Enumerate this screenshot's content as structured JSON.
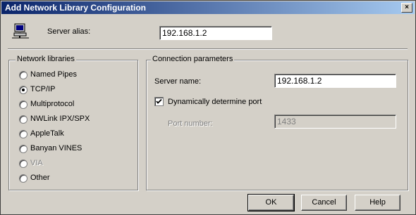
{
  "window": {
    "title": "Add Network Library Configuration",
    "close_glyph": "×"
  },
  "server_alias": {
    "label": "Server alias:",
    "value": "192.168.1.2"
  },
  "network_libraries": {
    "title": "Network libraries",
    "options": [
      {
        "label": "Named Pipes",
        "checked": false,
        "disabled": false
      },
      {
        "label": "TCP/IP",
        "checked": true,
        "disabled": false
      },
      {
        "label": "Multiprotocol",
        "checked": false,
        "disabled": false
      },
      {
        "label": "NWLink IPX/SPX",
        "checked": false,
        "disabled": false
      },
      {
        "label": "AppleTalk",
        "checked": false,
        "disabled": false
      },
      {
        "label": "Banyan VINES",
        "checked": false,
        "disabled": false
      },
      {
        "label": "VIA",
        "checked": false,
        "disabled": true
      },
      {
        "label": "Other",
        "checked": false,
        "disabled": false
      }
    ]
  },
  "connection": {
    "title": "Connection parameters",
    "server_name_label": "Server name:",
    "server_name_value": "192.168.1.2",
    "dynamic_port_label": "Dynamically determine port",
    "dynamic_port_checked": true,
    "port_label": "Port number:",
    "port_value": "1433"
  },
  "buttons": {
    "ok": "OK",
    "cancel": "Cancel",
    "help": "Help"
  },
  "icons": {
    "computer": "computer-icon"
  }
}
